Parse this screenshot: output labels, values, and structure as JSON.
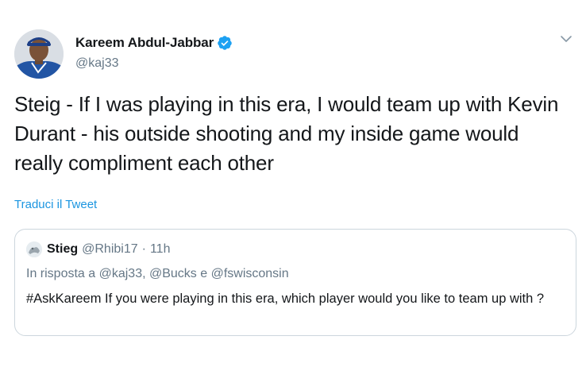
{
  "tweet": {
    "author": {
      "display_name": "Kareem Abdul-Jabbar",
      "handle": "@kaj33",
      "verified": true
    },
    "text": "Steig - If I was playing in this era, I would team up with Kevin Durant - his outside shooting and my inside game would really compliment each other",
    "translate_label": "Traduci il Tweet",
    "menu_icon": "chevron-down-icon"
  },
  "quoted_tweet": {
    "author": {
      "display_name": "Stieg",
      "handle": "@Rhibi17",
      "separator": "·",
      "time": "11h"
    },
    "reply_to": "In risposta a @kaj33, @Bucks e @fswisconsin",
    "text": "#AskKareem If you were playing in this era, which player would you like to team up with ?"
  },
  "colors": {
    "link": "#1b95e0",
    "secondary_text": "#657786",
    "border": "#ccd6dd",
    "primary_text": "#14171a"
  }
}
